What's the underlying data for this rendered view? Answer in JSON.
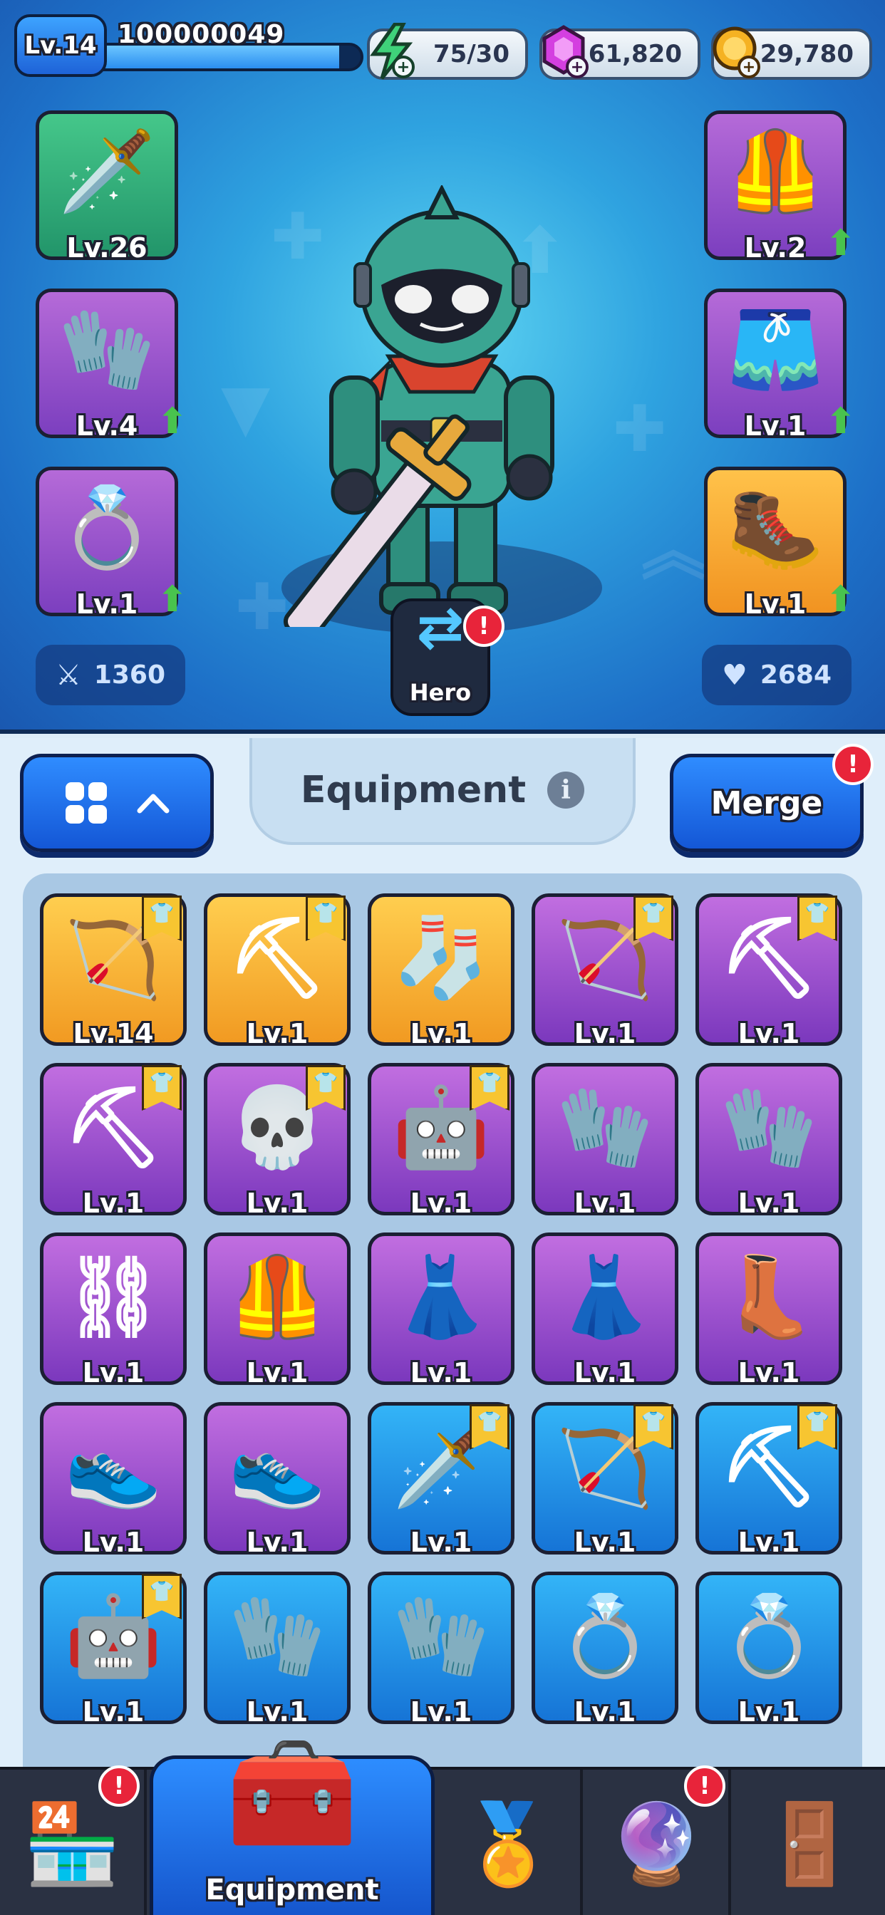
{
  "player": {
    "level": "Lv.14",
    "id": "100000049",
    "xp_fraction": 0.93
  },
  "currencies": [
    {
      "name": "energy",
      "icon": "lightning-icon",
      "value": "75/30",
      "color": "#36c46a"
    },
    {
      "name": "gems",
      "icon": "gem-icon",
      "value": "61,820",
      "color": "#d43fe0"
    },
    {
      "name": "coins",
      "icon": "coin-icon",
      "value": "29,780",
      "color": "#f5b223"
    }
  ],
  "equipped": {
    "weapon": {
      "level": "Lv.26",
      "rarity": "green",
      "icon": "sword-icon",
      "upgradable": false
    },
    "gloves": {
      "level": "Lv.4",
      "rarity": "purple",
      "icon": "glove-icon",
      "upgradable": true
    },
    "ring": {
      "level": "Lv.1",
      "rarity": "purple",
      "icon": "ring-icon",
      "upgradable": true
    },
    "armor": {
      "level": "Lv.2",
      "rarity": "purple",
      "icon": "armor-icon",
      "upgradable": true
    },
    "pants": {
      "level": "Lv.1",
      "rarity": "purple",
      "icon": "pants-icon",
      "upgradable": true
    },
    "boots": {
      "level": "Lv.1",
      "rarity": "orange",
      "icon": "boot-icon",
      "upgradable": true
    }
  },
  "stats": {
    "attack": "1360",
    "health": "2684"
  },
  "hero_button": {
    "label": "Hero",
    "alert": "!"
  },
  "panel": {
    "title": "Equipment",
    "info_symbol": "i",
    "merge_label": "Merge",
    "merge_alert": "!"
  },
  "inventory": [
    {
      "level": "Lv.14",
      "rarity": "orange",
      "icon": "bow-icon",
      "tagged": true
    },
    {
      "level": "Lv.1",
      "rarity": "orange",
      "icon": "scythe-icon",
      "tagged": true
    },
    {
      "level": "Lv.1",
      "rarity": "orange",
      "icon": "sock-icon",
      "tagged": false
    },
    {
      "level": "Lv.1",
      "rarity": "purple",
      "icon": "bow-icon",
      "tagged": true
    },
    {
      "level": "Lv.1",
      "rarity": "purple",
      "icon": "scythe-icon",
      "tagged": true
    },
    {
      "level": "Lv.1",
      "rarity": "purple",
      "icon": "scythe-icon",
      "tagged": true
    },
    {
      "level": "Lv.1",
      "rarity": "purple",
      "icon": "skull-can-icon",
      "tagged": true
    },
    {
      "level": "Lv.1",
      "rarity": "purple",
      "icon": "robot-icon",
      "tagged": true
    },
    {
      "level": "Lv.1",
      "rarity": "purple",
      "icon": "glove-icon",
      "tagged": false
    },
    {
      "level": "Lv.1",
      "rarity": "purple",
      "icon": "glove-icon",
      "tagged": false
    },
    {
      "level": "Lv.1",
      "rarity": "purple",
      "icon": "chain-icon",
      "tagged": false
    },
    {
      "level": "Lv.1",
      "rarity": "purple",
      "icon": "armor-icon",
      "tagged": false
    },
    {
      "level": "Lv.1",
      "rarity": "purple",
      "icon": "skirt-icon",
      "tagged": false
    },
    {
      "level": "Lv.1",
      "rarity": "purple",
      "icon": "skirt-icon",
      "tagged": false
    },
    {
      "level": "Lv.1",
      "rarity": "purple",
      "icon": "boot-icon",
      "tagged": false
    },
    {
      "level": "Lv.1",
      "rarity": "purple",
      "icon": "sneaker-icon",
      "tagged": false
    },
    {
      "level": "Lv.1",
      "rarity": "purple",
      "icon": "sneaker-icon",
      "tagged": false
    },
    {
      "level": "Lv.1",
      "rarity": "blue",
      "icon": "sword-icon",
      "tagged": true
    },
    {
      "level": "Lv.1",
      "rarity": "blue",
      "icon": "bow-icon",
      "tagged": true
    },
    {
      "level": "Lv.1",
      "rarity": "blue",
      "icon": "scythe-icon",
      "tagged": true
    },
    {
      "level": "Lv.1",
      "rarity": "blue",
      "icon": "robot-icon",
      "tagged": true
    },
    {
      "level": "Lv.1",
      "rarity": "blue",
      "icon": "glove-icon",
      "tagged": false
    },
    {
      "level": "Lv.1",
      "rarity": "blue",
      "icon": "glove-icon",
      "tagged": false
    },
    {
      "level": "Lv.1",
      "rarity": "blue",
      "icon": "ring-icon",
      "tagged": false
    },
    {
      "level": "Lv.1",
      "rarity": "blue",
      "icon": "ring-icon",
      "tagged": false
    }
  ],
  "bottom_nav": {
    "shop_alert": "!",
    "equipment_label": "Equipment",
    "portal_alert": "!"
  }
}
